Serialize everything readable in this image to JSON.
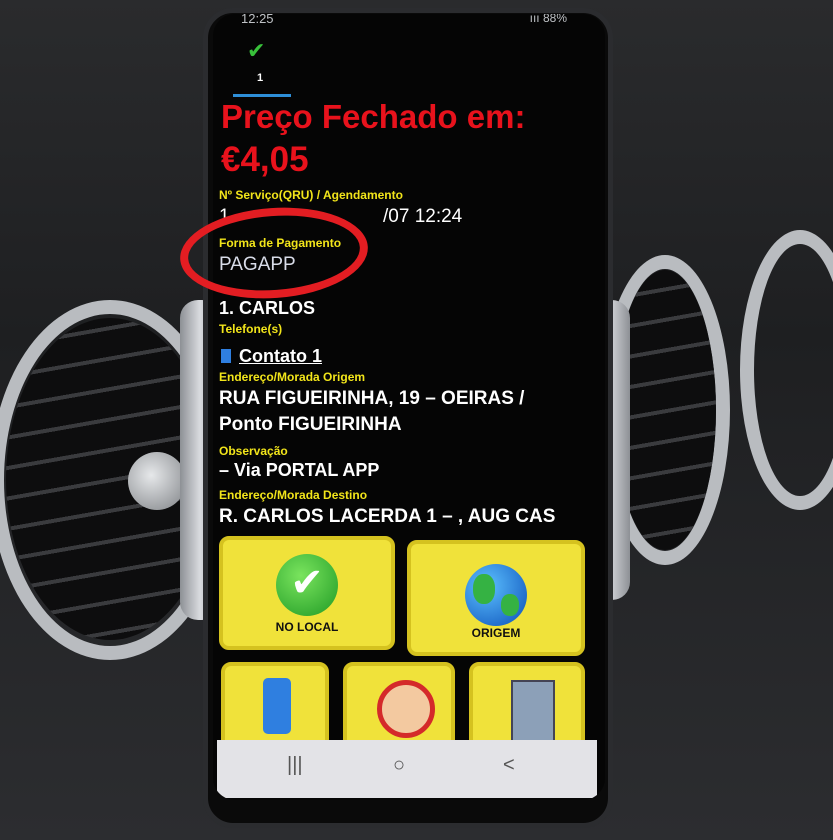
{
  "status_bar": {
    "time": "12:25",
    "right": "ııı 88%"
  },
  "tabs": {
    "selected_check": "✔",
    "count": "1"
  },
  "price_header": {
    "title": "Preço Fechado em:",
    "price": "€4,05"
  },
  "fields": {
    "service_label": "Nº Serviço(QRU) / Agendamento",
    "service_value": "1",
    "service_date": "/07 12:24",
    "payment_label": "Forma de Pagamento",
    "payment_value": "PAGAPP",
    "passenger_name": "1. CARLOS",
    "phone_label": "Telefone(s)",
    "contact_value": "Contato 1",
    "origin_label": "Endereço/Morada Origem",
    "origin_value_1": "RUA FIGUEIRINHA, 19 – OEIRAS /",
    "origin_value_2": "Ponto FIGUEIRINHA",
    "observation_label": "Observação",
    "observation_value": "– Via PORTAL APP",
    "destination_label": "Endereço/Morada Destino",
    "destination_value": "R. CARLOS LACERDA 1 – , AUG CAS"
  },
  "buttons": {
    "no_local": "NO LOCAL",
    "origem": "ORIGEM"
  },
  "nav_bar": {
    "recent": "|||",
    "home": "○",
    "back": "<"
  },
  "colors": {
    "title_red": "#e8121c",
    "label_yellow": "#f2e51a",
    "tile_yellow": "#f0e23a",
    "annotation_red": "#e31d22"
  },
  "icons": [
    "check-icon",
    "globe-icon",
    "phone-taxi-icon",
    "support-agent-icon",
    "file-cabinet-icon"
  ]
}
